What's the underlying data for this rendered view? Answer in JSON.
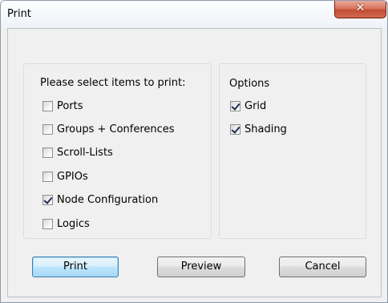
{
  "window": {
    "title": "Print",
    "close_icon": "close-icon"
  },
  "items_group": {
    "heading": "Please select items to print:",
    "items": [
      {
        "label": "Ports",
        "checked": false
      },
      {
        "label": "Groups + Conferences",
        "checked": false
      },
      {
        "label": "Scroll-Lists",
        "checked": false
      },
      {
        "label": "GPIOs",
        "checked": false
      },
      {
        "label": "Node Configuration",
        "checked": true
      },
      {
        "label": "Logics",
        "checked": false
      }
    ]
  },
  "options_group": {
    "heading": "Options",
    "items": [
      {
        "label": "Grid",
        "checked": true
      },
      {
        "label": "Shading",
        "checked": true
      }
    ]
  },
  "buttons": {
    "print": "Print",
    "preview": "Preview",
    "cancel": "Cancel"
  }
}
